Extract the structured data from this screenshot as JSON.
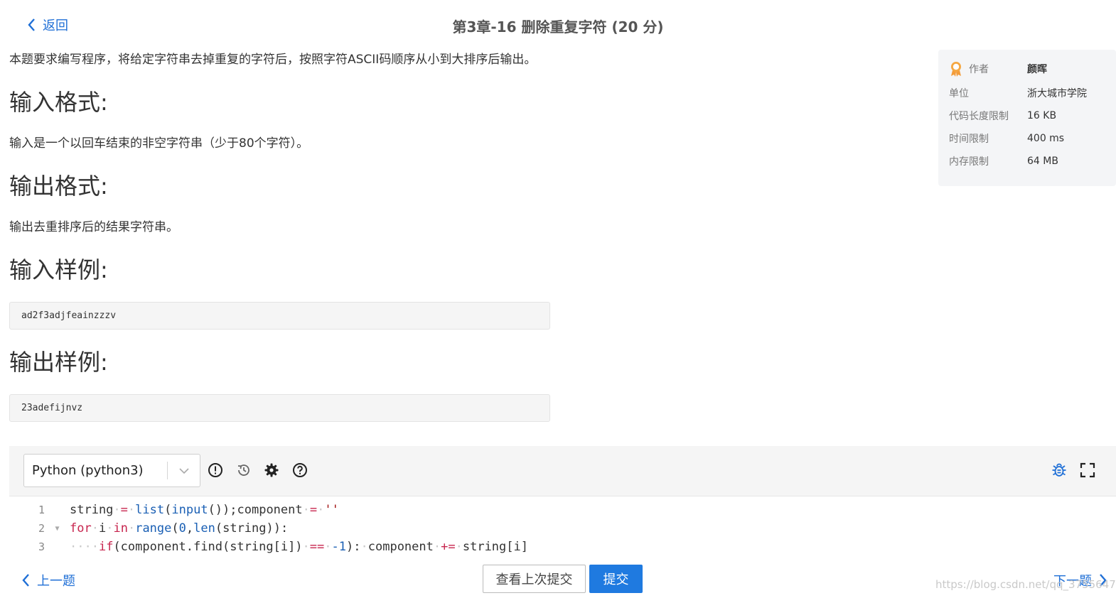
{
  "header": {
    "back_label": "返回",
    "title": "第3章-16 删除重复字符 (20 分)"
  },
  "problem": {
    "intro": "本题要求编写程序，将给定字符串去掉重复的字符后，按照字符ASCII码顺序从小到大排序后输出。",
    "input_format_heading": "输入格式:",
    "input_format_text": "输入是一个以回车结束的非空字符串（少于80个字符）。",
    "output_format_heading": "输出格式:",
    "output_format_text": "输出去重排序后的结果字符串。",
    "sample_input_heading": "输入样例:",
    "sample_input": "ad2f3adjfeainzzzv",
    "sample_output_heading": "输出样例:",
    "sample_output": "23adefijnvz"
  },
  "info": {
    "author_label": "作者",
    "author_value": "颜晖",
    "unit_label": "单位",
    "unit_value": "浙大城市学院",
    "code_limit_label": "代码长度限制",
    "code_limit_value": "16 KB",
    "time_limit_label": "时间限制",
    "time_limit_value": "400 ms",
    "memory_limit_label": "内存限制",
    "memory_limit_value": "64 MB"
  },
  "editor": {
    "language": "Python (python3)",
    "line_numbers": [
      "1",
      "2",
      "3"
    ]
  },
  "footer": {
    "prev_label": "上一题",
    "history_label": "查看上次提交",
    "submit_label": "提交",
    "next_label": "下一题",
    "watermark": "https://blog.csdn.net/qq_37556470"
  },
  "colors": {
    "link": "#1f6fd6",
    "submit": "#1f7ae0",
    "keyword": "#c7254e",
    "builtin": "#1a5fb4"
  }
}
